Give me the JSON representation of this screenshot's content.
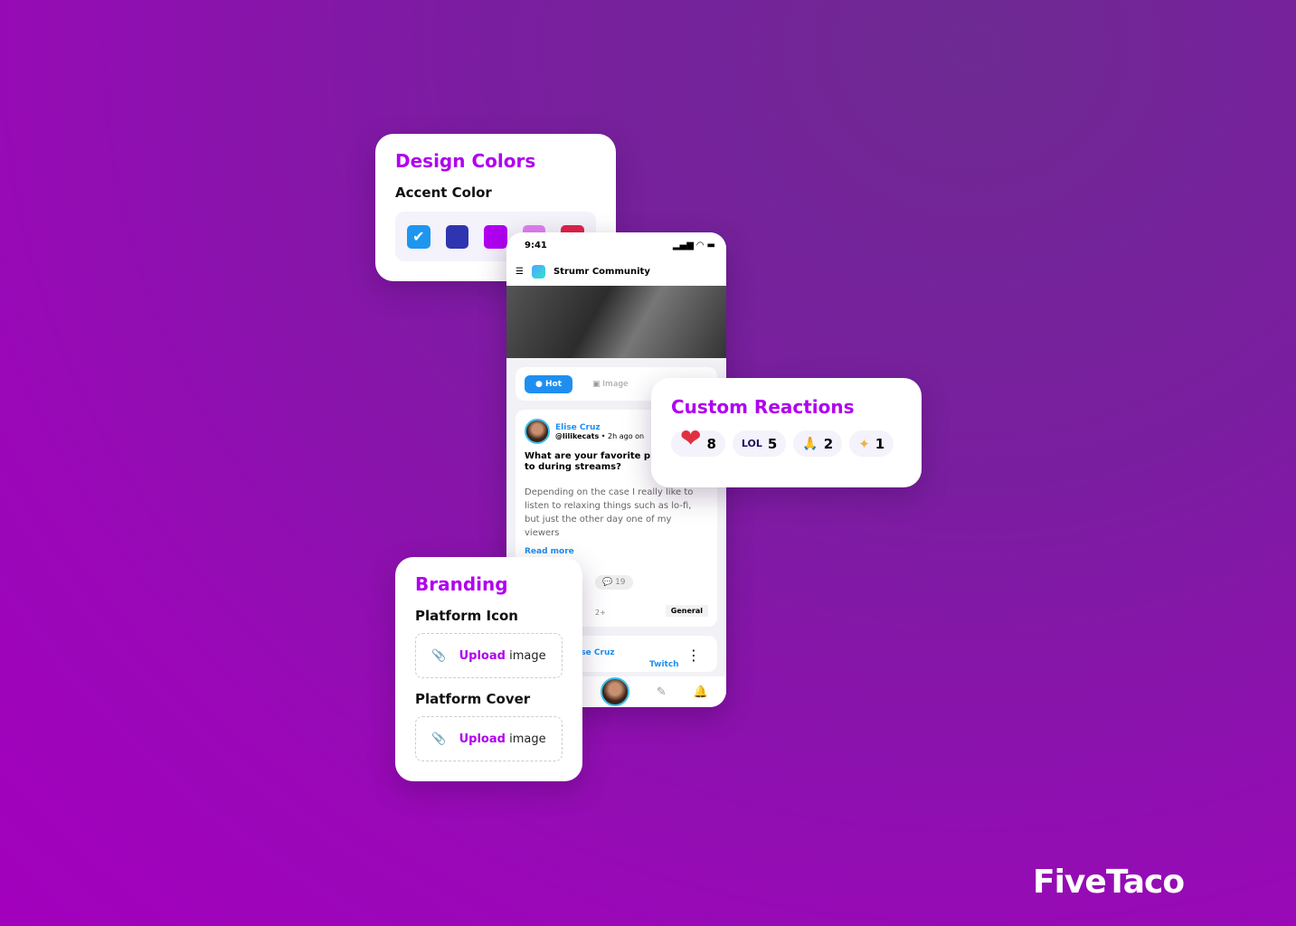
{
  "design_colors": {
    "title": "Design Colors",
    "subtitle": "Accent Color",
    "swatches": [
      "#1e96f0",
      "#2f35b0",
      "#b000f0",
      "#e080f0",
      "#e0234a"
    ],
    "selected": 0
  },
  "phone": {
    "time": "9:41",
    "app_name": "Strumr Community",
    "tabs": {
      "hot": "Hot",
      "image": "Image"
    },
    "post": {
      "author": "Elise Cruz",
      "handle": "@lilikecats",
      "meta": "• 2h ago on",
      "title": "What are your favorite play listen to during streams?",
      "body": "Depending on the case I really like to listen to relaxing things such as lo-fi, but just the other day one of my viewers",
      "read_more": "Read more",
      "comments": "19",
      "participants": "2+",
      "tag": "General"
    },
    "post2": {
      "author": "Elise Cruz",
      "platform": "Twitch"
    }
  },
  "reactions": {
    "title": "Custom Reactions",
    "items": [
      {
        "icon": "heart",
        "count": "8"
      },
      {
        "icon": "LOL",
        "count": "5"
      },
      {
        "icon": "pray",
        "count": "2"
      },
      {
        "icon": "sparkles",
        "count": "1"
      }
    ]
  },
  "branding": {
    "title": "Branding",
    "icon_label": "Platform Icon",
    "cover_label": "Platform Cover",
    "upload": "Upload",
    "image": "image"
  },
  "brand_logo": "FiveTaco"
}
